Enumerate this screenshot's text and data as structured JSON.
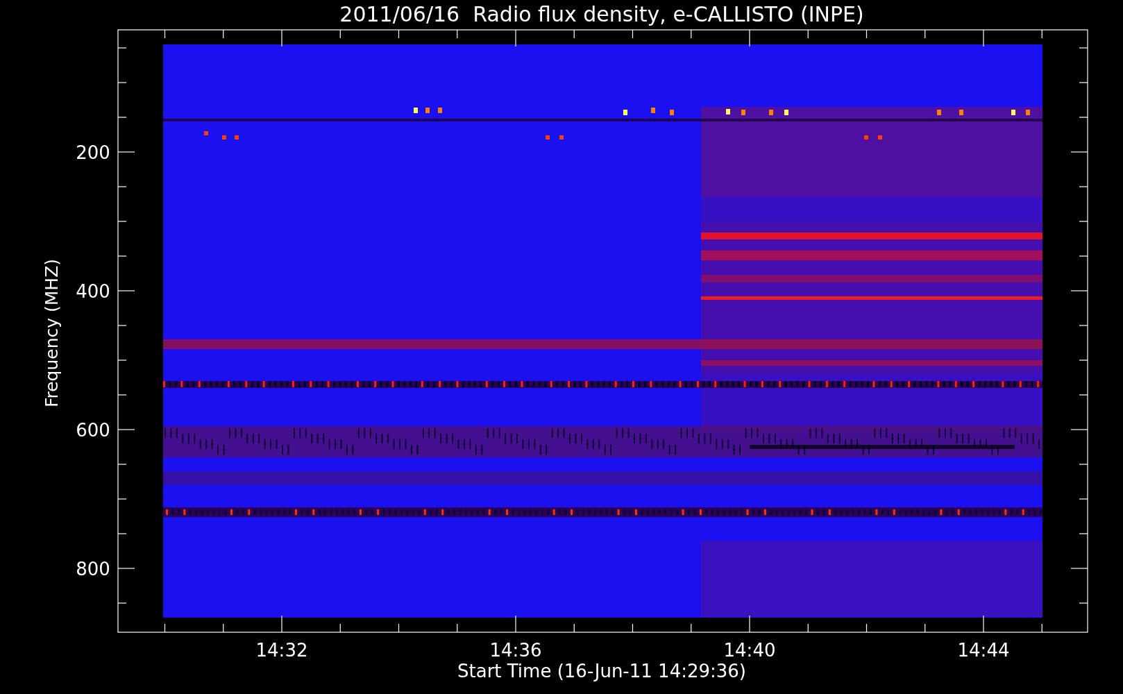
{
  "chart": {
    "title": "2011/06/16  Radio flux density, e-CALLISTO (INPE)",
    "ylabel": "Frequency (MHZ)",
    "xlabel": "Start Time (16-Jun-11 14:29:36)",
    "yticks": [
      "200",
      "400",
      "600",
      "800"
    ],
    "xticks": [
      "14:32",
      "14:36",
      "14:40",
      "14:44"
    ]
  }
}
